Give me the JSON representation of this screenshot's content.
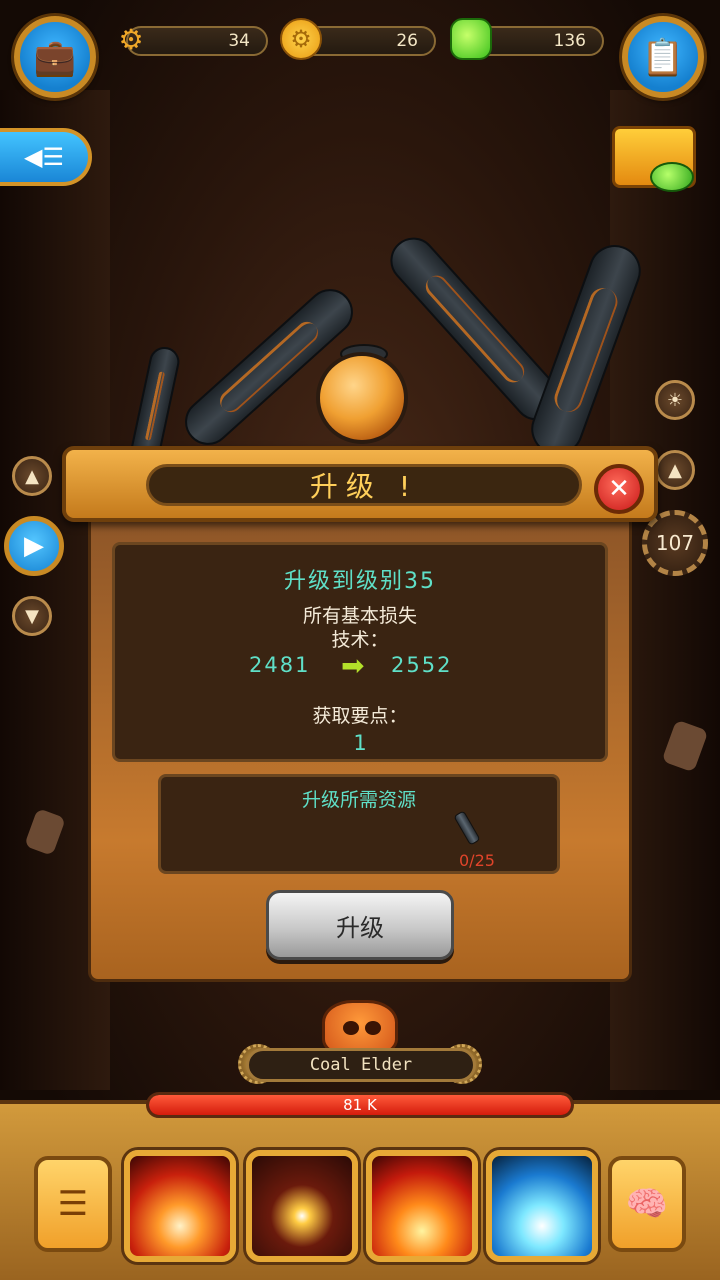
{
  "resources": {
    "gears": "34",
    "coins": "26",
    "gems": "136"
  },
  "dialog": {
    "title": "升级 !",
    "upgrade_to": "升级到级别35",
    "all_base_damage": "所有基本损失",
    "tech_label": "技术：",
    "old_value": "2481",
    "new_value": "2552",
    "gain_points_label": "获取要点：",
    "points": "1",
    "resources_needed_label": "升级所需资源",
    "resource_progress": "0/25",
    "upgrade_button": "升级"
  },
  "side": {
    "level": "107"
  },
  "boss": {
    "name": "Coal Elder",
    "hp_text": "81 K"
  },
  "icons": {
    "briefcase": "briefcase-icon",
    "clipboard": "clipboard-icon",
    "gear": "gear-icon",
    "coin": "coin-icon",
    "gem": "gem-icon",
    "menu": "menu-icon",
    "chest": "treasure-chest-icon",
    "sun": "sun-icon",
    "close": "close-icon",
    "arrow": "arrow-right-icon",
    "brain": "brain-icon",
    "list": "list-icon"
  },
  "colors": {
    "accent_gold": "#e7a936",
    "title_text": "#ffcf5a",
    "cyan_text": "#5fe0c8",
    "hp_red": "#d41c0c",
    "resource_red": "#e0442a"
  }
}
